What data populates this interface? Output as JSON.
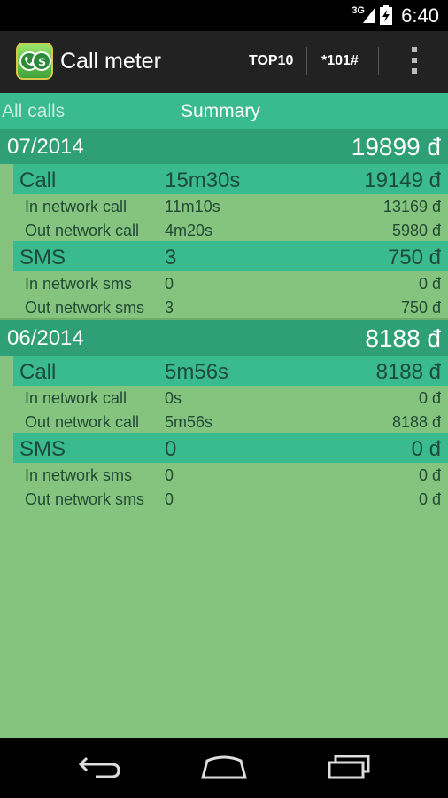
{
  "status_bar": {
    "network": "3G",
    "time": "6:40"
  },
  "action_bar": {
    "title": "Call meter",
    "top10_label": "TOP10",
    "ussd_label": "*101#"
  },
  "tabs": [
    {
      "label": "All calls",
      "selected": false
    },
    {
      "label": "Summary",
      "selected": true
    }
  ],
  "months": [
    {
      "label": "07/2014",
      "total": "19899 đ",
      "categories": [
        {
          "name": "Call",
          "qty": "15m30s",
          "amount": "19149 đ",
          "rows": [
            {
              "name": "In network call",
              "qty": "11m10s",
              "amount": "13169 đ"
            },
            {
              "name": "Out network call",
              "qty": "4m20s",
              "amount": "5980 đ"
            }
          ]
        },
        {
          "name": "SMS",
          "qty": "3",
          "amount": "750 đ",
          "rows": [
            {
              "name": "In network sms",
              "qty": "0",
              "amount": "0 đ"
            },
            {
              "name": "Out network sms",
              "qty": "3",
              "amount": "750 đ"
            }
          ]
        }
      ]
    },
    {
      "label": "06/2014",
      "total": "8188 đ",
      "categories": [
        {
          "name": "Call",
          "qty": "5m56s",
          "amount": "8188 đ",
          "rows": [
            {
              "name": "In network call",
              "qty": "0s",
              "amount": "0 đ"
            },
            {
              "name": "Out network call",
              "qty": "5m56s",
              "amount": "8188 đ"
            }
          ]
        },
        {
          "name": "SMS",
          "qty": "0",
          "amount": "0 đ",
          "rows": [
            {
              "name": "In network sms",
              "qty": "0",
              "amount": "0 đ"
            },
            {
              "name": "Out network sms",
              "qty": "0",
              "amount": "0 đ"
            }
          ]
        }
      ]
    }
  ],
  "icons": {
    "app": "call-meter-app-icon",
    "overflow": "overflow-menu-icon",
    "back": "back-icon",
    "home": "home-icon",
    "recents": "recents-icon"
  },
  "colors": {
    "content_bg": "#84c47e",
    "tab_bar": "#3aba8f",
    "month_header": "#2f9f77",
    "category_header": "#3aba8f"
  }
}
